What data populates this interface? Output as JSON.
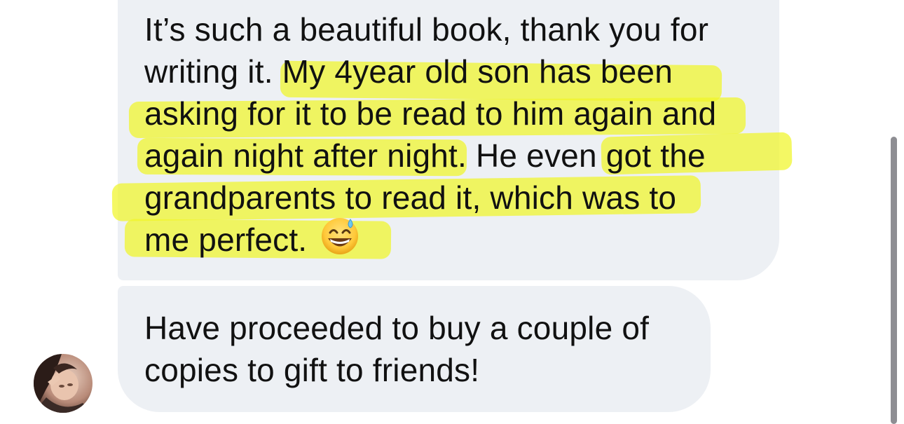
{
  "messages": [
    {
      "lines": [
        "It’s such a beautiful book, thank you for",
        "writing it. My 4year old son has been",
        "asking for it to be read to him again and",
        "again night after night. He even got the",
        "grandparents to read it, which was to",
        "me perfect."
      ],
      "emoji": "grinning-face-with-sweat-icon"
    },
    {
      "lines": [
        "Have proceeded to buy a couple of",
        "copies to gift to friends!"
      ]
    }
  ],
  "colors": {
    "bubble": "#EDF0F4",
    "highlight": "#F0F528",
    "text": "#111111",
    "scrollbar": "#8E8E93"
  }
}
